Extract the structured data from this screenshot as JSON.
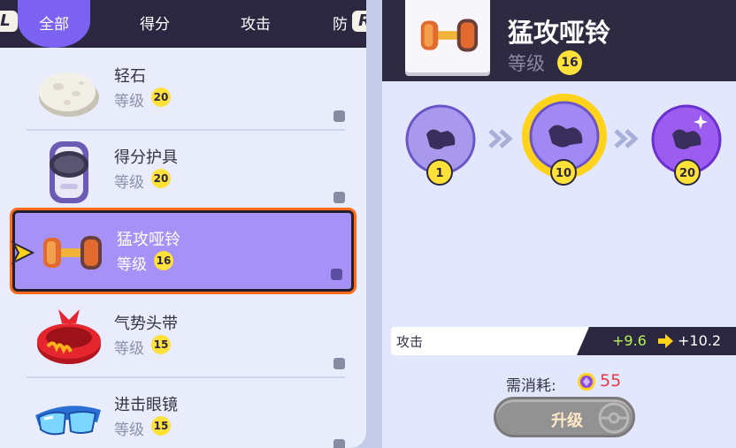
{
  "tabs": {
    "shoulder_left": "L",
    "shoulder_right": "R",
    "items": [
      "全部",
      "得分",
      "攻击",
      "防"
    ]
  },
  "item_list": {
    "level_label": "等级",
    "items": [
      {
        "name": "轻石",
        "level": "20",
        "icon": "rock-icon"
      },
      {
        "name": "得分护具",
        "level": "20",
        "icon": "scoring-armor-icon"
      },
      {
        "name": "猛攻哑铃",
        "level": "16",
        "icon": "dumbbell-icon",
        "selected": true
      },
      {
        "name": "气势头带",
        "level": "15",
        "icon": "headband-icon"
      },
      {
        "name": "进击眼镜",
        "level": "15",
        "icon": "goggles-icon"
      }
    ]
  },
  "detail": {
    "title": "猛攻哑铃",
    "level_label": "等级",
    "level": "16",
    "tiers": [
      "1",
      "10",
      "20"
    ],
    "stat_label": "攻击",
    "stat_from": "+9.6",
    "stat_to": "+10.2",
    "cost_label": "需消耗:",
    "cost_value": "55",
    "upgrade_label": "升级"
  },
  "colors": {
    "accent": "#7b62f0",
    "selected_bg": "#a692f6",
    "selection_glow": "#ff6a1c",
    "level_badge": "#ffe13a",
    "cost_red": "#e5394a",
    "stat_green": "#b5f25b"
  }
}
